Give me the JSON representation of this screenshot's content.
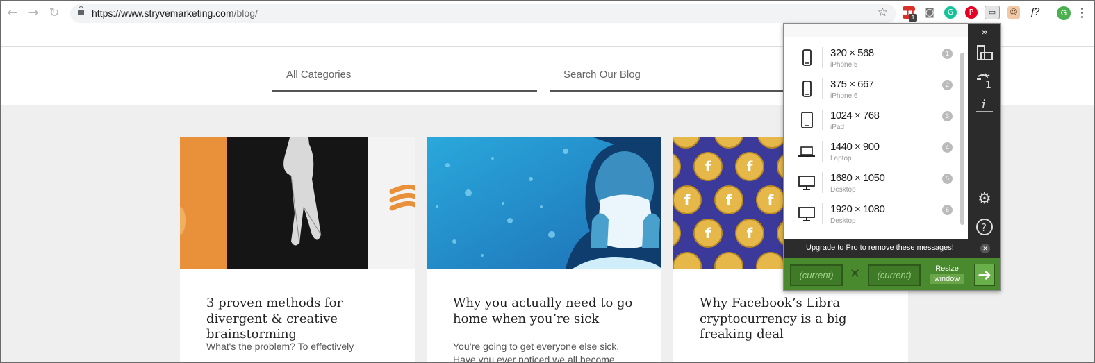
{
  "browser": {
    "url_host": "https://www.stryvemarketing.com",
    "url_path": "/blog/",
    "extension_badge": "1",
    "profile_initial": "G",
    "font_ext_label": "f?"
  },
  "blog": {
    "category_filter": "All Categories",
    "search_placeholder": "Search Our Blog",
    "posts": [
      {
        "title": "3 proven methods for divergent & creative brainstorming",
        "excerpt": "What's the problem? To effectively"
      },
      {
        "title": "Why you actually need to go home when you’re sick",
        "excerpt": "You’re going to get everyone else sick. Have you ever noticed we all become"
      },
      {
        "title": "Why Facebook’s Libra cryptocurrency is a big freaking deal",
        "excerpt": ""
      }
    ]
  },
  "resizer": {
    "presets": [
      {
        "dims": "320 × 568",
        "label": "iPhone 5",
        "num": "1",
        "icon": "phone-icon"
      },
      {
        "dims": "375 × 667",
        "label": "iPhone 6",
        "num": "2",
        "icon": "phone-icon"
      },
      {
        "dims": "1024 × 768",
        "label": "iPad",
        "num": "3",
        "icon": "tablet-icon"
      },
      {
        "dims": "1440 × 900",
        "label": "Laptop",
        "num": "4",
        "icon": "laptop-icon"
      },
      {
        "dims": "1680 × 1050",
        "label": "Desktop",
        "num": "5",
        "icon": "desktop-icon"
      },
      {
        "dims": "1920 × 1080",
        "label": "Desktop",
        "num": "6",
        "icon": "desktop-icon"
      }
    ],
    "upgrade_text": "Upgrade to Pro to remove these messages!",
    "width_placeholder": "(current)",
    "height_placeholder": "(current)",
    "times_sign": "✕",
    "resize_label": "Resize",
    "window_label": "window"
  },
  "colors": {
    "accent_green": "#4a8a2e",
    "card_orange": "#e8913a",
    "sky_blue": "#2aa8dc",
    "coin_purple": "#3b3a9a"
  }
}
